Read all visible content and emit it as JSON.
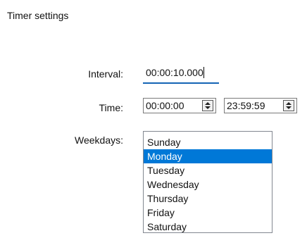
{
  "panel": {
    "title": "Timer settings"
  },
  "interval": {
    "label": "Interval:",
    "value": "00:00:10.000"
  },
  "time": {
    "label": "Time:",
    "start_value": "00:00:00",
    "end_value": "23:59:59",
    "spin_icon": "up-down-arrows-icon"
  },
  "weekdays": {
    "label": "Weekdays:",
    "items": [
      "Sunday",
      "Monday",
      "Tuesday",
      "Wednesday",
      "Thursday",
      "Friday",
      "Saturday"
    ],
    "selected": "Monday"
  },
  "colors": {
    "selection": "#0078d7",
    "focus_underline": "#1464b4"
  }
}
